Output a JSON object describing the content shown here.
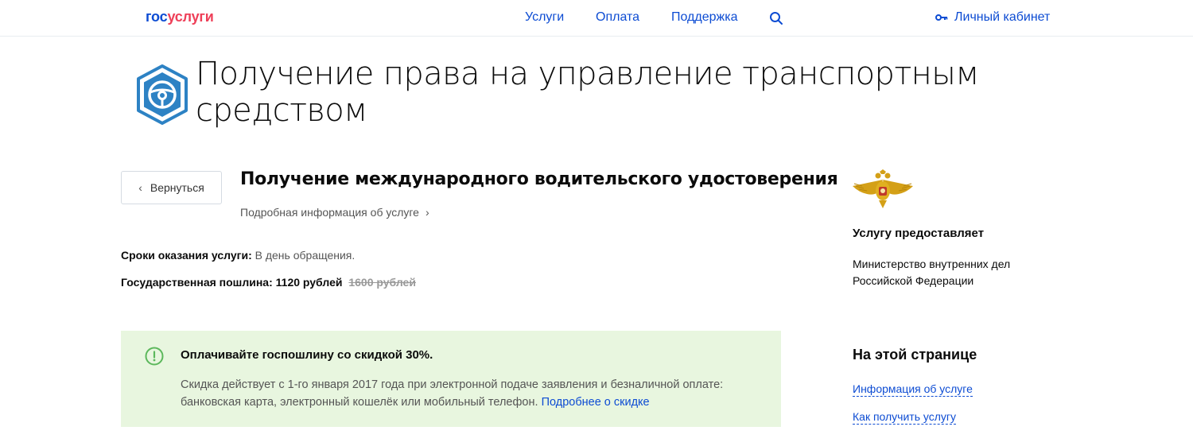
{
  "header": {
    "logo_part1": "гос",
    "logo_part2": "услуги",
    "nav": {
      "services": "Услуги",
      "payment": "Оплата",
      "support": "Поддержка"
    },
    "cabinet": "Личный кабинет"
  },
  "hero": {
    "title": "Получение права на управление транспортным средством"
  },
  "service": {
    "back_label": "Вернуться",
    "title": "Получение международного водительского удостоверения",
    "more_info": "Подробная информация об услуге",
    "terms_label": "Сроки оказания услуги:",
    "terms_value": "В день обращения.",
    "fee_label": "Государственная пошлина:",
    "fee_value": "1120 рублей",
    "fee_old": "1600 рублей"
  },
  "discount": {
    "title": "Оплачивайте госпошлину со скидкой 30%.",
    "text": "Скидка действует с 1-го января 2017 года при электронной подаче заявления и безналичной оплате: банковская карта, электронный кошелёк или мобильный телефон.",
    "link": "Подробнее о скидке"
  },
  "sidebar": {
    "provider_heading": "Услугу предоставляет",
    "provider_name": "Министерство внутренних дел Российской Федерации",
    "onpage_heading": "На этой странице",
    "links": [
      "Информация об услуге",
      "Как получить услугу"
    ]
  },
  "colors": {
    "brand_blue": "#0d4cd3",
    "brand_red": "#ee3f58",
    "icon_blue": "#2d82c4",
    "discount_bg": "#e8f6df",
    "discount_icon": "#5cb85c"
  },
  "icons": {
    "search": "search-icon",
    "key": "key-icon",
    "steering": "steering-wheel-icon",
    "alert": "exclamation-circle-icon",
    "emblem": "eagle-emblem-icon"
  }
}
